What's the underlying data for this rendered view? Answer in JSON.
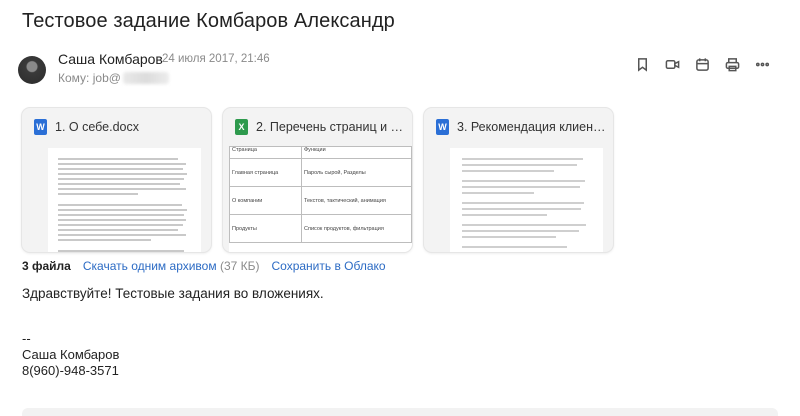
{
  "subject": "Тестовое задание Комбаров Александр",
  "sender": {
    "name": "Саша Комбаров",
    "date": "24 июля 2017, 21:46",
    "to_label": "Кому:",
    "to_value": "job@"
  },
  "actions": [
    {
      "name": "bookmark-icon"
    },
    {
      "name": "video-icon"
    },
    {
      "name": "calendar-icon"
    },
    {
      "name": "print-icon"
    },
    {
      "name": "more-icon"
    }
  ],
  "attachments": [
    {
      "icon": "W",
      "icon_type": "word",
      "name": "1. О себе.docx"
    },
    {
      "icon": "X",
      "icon_type": "excel",
      "name": "2. Перечень страниц и фу…",
      "preview_table": {
        "headers": [
          "Страница",
          "Функции"
        ],
        "rows": [
          [
            "Главная страница",
            "Пароль сырой, Разделы"
          ],
          [
            "О компании",
            "Текстов, тактический, анимация"
          ],
          [
            "Продукты",
            "Список продуктов, фильтрация"
          ]
        ]
      }
    },
    {
      "icon": "W",
      "icon_type": "word",
      "name": "3. Рекомендация клиенту…."
    }
  ],
  "attach_bar": {
    "count": "3 файла",
    "download_all": "Скачать одним архивом",
    "size": "(37 КБ)",
    "save_cloud": "Сохранить в Облако"
  },
  "body_text": "Здравствуйте! Тестовые задания во вложениях.",
  "signature": {
    "dashes": "--",
    "name": "Саша Комбаров",
    "phone": "8(960)-948-3571"
  }
}
